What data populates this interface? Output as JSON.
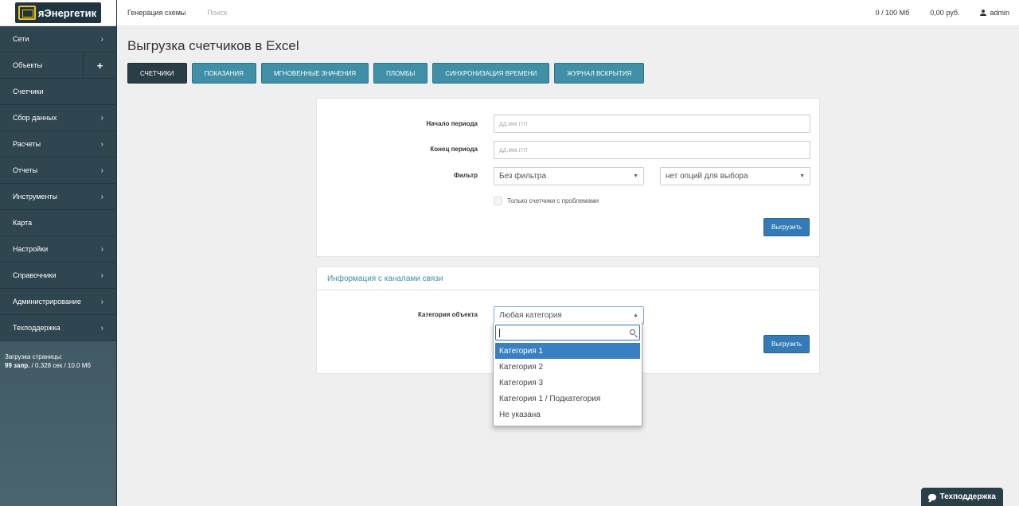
{
  "brand": {
    "logo_text": "яЭнергетик"
  },
  "sidebar": {
    "items": [
      {
        "label": "Сети",
        "icon": "›"
      },
      {
        "label": "Объекты",
        "icon": "+"
      },
      {
        "label": "Счетчики",
        "icon": ""
      },
      {
        "label": "Сбор данных",
        "icon": "›"
      },
      {
        "label": "Расчеты",
        "icon": "›"
      },
      {
        "label": "Отчеты",
        "icon": "›"
      },
      {
        "label": "Инструменты",
        "icon": "›"
      },
      {
        "label": "Карта",
        "icon": ""
      },
      {
        "label": "Настройки",
        "icon": "›"
      },
      {
        "label": "Справочники",
        "icon": "›"
      },
      {
        "label": "Администрирование",
        "icon": "›"
      },
      {
        "label": "Техподдержка",
        "icon": "›"
      }
    ],
    "load_title": "Загрузка страницы:",
    "load_queries": "99 запр.",
    "load_details": " / 0.328 сек / 10.0 Мб"
  },
  "topbar": {
    "scheme_link": "Генерация схемы",
    "search": "Поиск",
    "storage": "0 / 100 Мб",
    "balance": "0,00 руб.",
    "user": "admin"
  },
  "page": {
    "title": "Выгрузка счетчиков в Excel",
    "tabs": [
      {
        "label": "СЧЕТЧИКИ",
        "active": true
      },
      {
        "label": "ПОКАЗАНИЯ",
        "active": false
      },
      {
        "label": "МГНОВЕННЫЕ ЗНАЧЕНИЯ",
        "active": false
      },
      {
        "label": "ПЛОМБЫ",
        "active": false
      },
      {
        "label": "СИНХРОНИЗАЦИЯ ВРЕМЕНИ",
        "active": false
      },
      {
        "label": "ЖУРНАЛ ВСКРЫТИЯ",
        "active": false
      }
    ]
  },
  "form1": {
    "start_label": "Начало периода",
    "start_placeholder": "дд.мм.гггг",
    "end_label": "Конец периода",
    "end_placeholder": "дд.мм.гггг",
    "filter_label": "Фильтр",
    "filter_value": "Без фильтра",
    "filter2_value": "нет опций для выбора",
    "problems_label": "Только счетчики с проблемами",
    "submit": "Выгрузить"
  },
  "form2": {
    "header": "Информация с каналами связи",
    "category_label": "Категория объекта",
    "category_value": "Любая категория",
    "submit": "Выгрузить",
    "options": [
      "Категория 1",
      "Категория 2",
      "Категория 3",
      "Категория 1 / Подкатегория",
      "Не указана"
    ],
    "selected_index": 0
  },
  "support_button": "Техподдержка"
}
